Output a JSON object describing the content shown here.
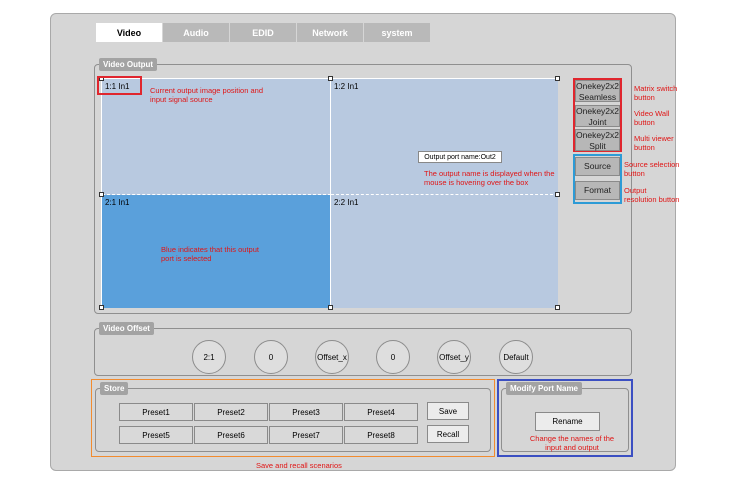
{
  "tabs": [
    "Video",
    "Audio",
    "EDID",
    "Network",
    "system"
  ],
  "video_output": {
    "title": "Video Output",
    "cells": [
      "1:1 In1",
      "1:2 In1",
      "2:1 In1",
      "2:2 In1"
    ],
    "selected_cell": "2:1",
    "tooltip": "Output port name:Out2"
  },
  "side_buttons": {
    "seamless": "Onekey2x2 Seamless",
    "joint": "Onekey2x2 Joint",
    "split": "Onekey2x2 Split",
    "source": "Source",
    "format": "Format"
  },
  "annotations": {
    "cell_position": "Current output image position and input signal source",
    "hover_name": "The output name is displayed when the mouse is hovering over the box",
    "selected": "Blue indicates that this output port is selected",
    "matrix_switch": "Matrix switch button",
    "video_wall": "Video Wall button",
    "multi_viewer": "Multi viewer button",
    "source_selection": "Source selection button",
    "output_resolution": "Output resolution button",
    "store": "Save and recall scenarios",
    "rename": "Change the names of the input and output"
  },
  "video_offset": {
    "title": "Video Offset",
    "controls": [
      "2:1",
      "0",
      "Offset_x",
      "0",
      "Offset_y",
      "Default"
    ]
  },
  "store": {
    "title": "Store",
    "presets": [
      "Preset1",
      "Preset2",
      "Preset3",
      "Preset4",
      "Preset5",
      "Preset6",
      "Preset7",
      "Preset8"
    ],
    "save": "Save",
    "recall": "Recall"
  },
  "modify_port_name": {
    "title": "Modify Port Name",
    "rename": "Rename"
  },
  "colors": {
    "cell": "#b8c9e0",
    "selected_cell": "#5aa0db",
    "annotation": "#e01515",
    "highlight_red": "#e0262e",
    "highlight_blue": "#2d9bd6",
    "highlight_orange": "#f28b2e",
    "highlight_navy": "#3b4fc2"
  }
}
